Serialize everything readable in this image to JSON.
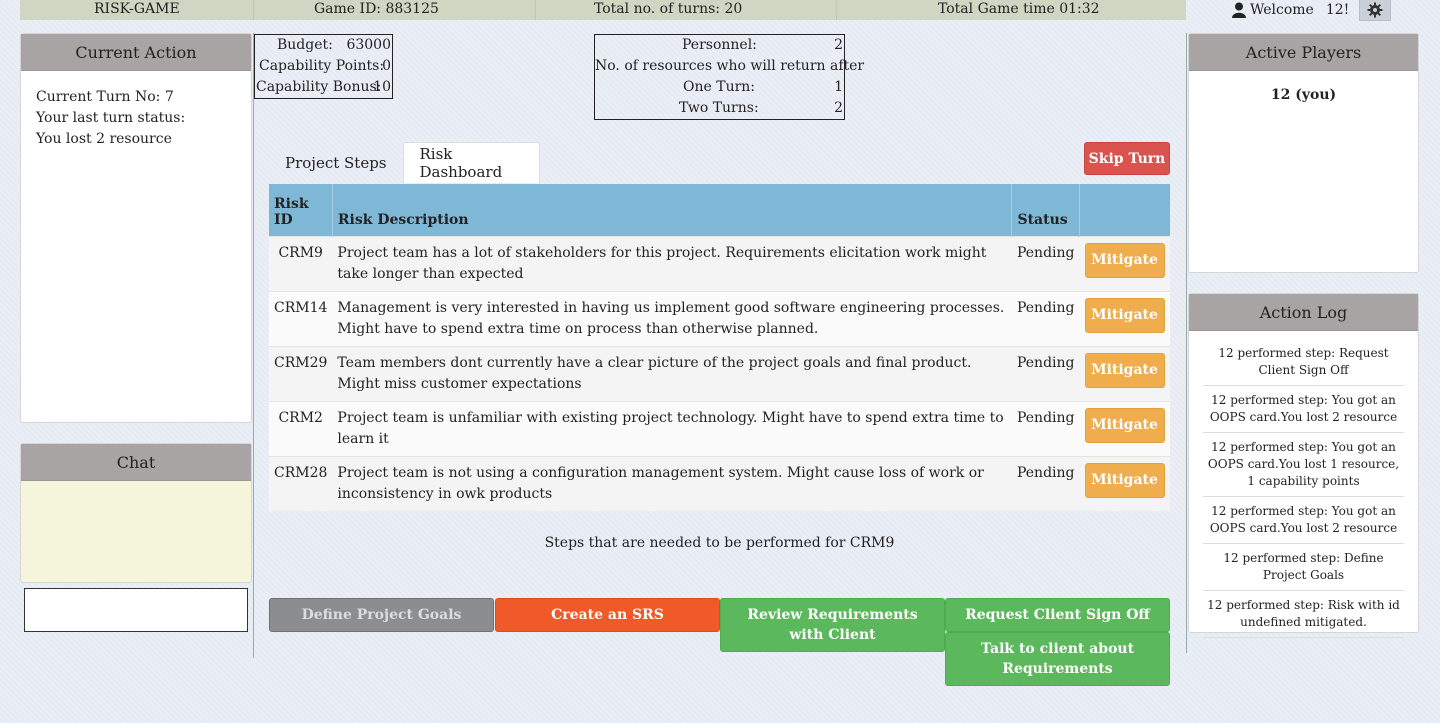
{
  "topbar": {
    "app_name": "RISK-GAME",
    "game_id": "Game  ID: 883125",
    "total_turns": "Total  no. of turns:  20",
    "total_time": "Total Game  time  01:32"
  },
  "user": {
    "welcome": "Welcome",
    "name": "12!"
  },
  "current_action": {
    "title": "Current  Action",
    "lines": [
      "Current  Turn No:  7",
      "Your  last turn  status:",
      "You lost 2 resource"
    ]
  },
  "chat": {
    "title": "Chat",
    "input_value": ""
  },
  "budget": {
    "budget_label": "Budget:",
    "budget_value": "63000",
    "cap_points_label": "Capability  Points:",
    "cap_points_value": "0",
    "cap_bonus_label": "Capability  Bonus:",
    "cap_bonus_value": "10"
  },
  "personnel": {
    "personnel_label": "Personnel:",
    "personnel_value": "2",
    "return_label": "No. of resources  who  will  return  after",
    "one_turn_label": "One  Turn:",
    "one_turn_value": "1",
    "two_turns_label": "Two  Turns:",
    "two_turns_value": "2"
  },
  "tabs": [
    {
      "label": "Project  Steps",
      "active": false
    },
    {
      "label": "Risk  Dashboard",
      "active": true
    }
  ],
  "skip_turn_label": "Skip Turn",
  "table": {
    "headers": {
      "risk_id": "Risk ID",
      "risk_id_l1": "Risk",
      "risk_id_l2": "ID",
      "desc": "Risk  Description",
      "status": "Status"
    },
    "rows": [
      {
        "id": "CRM9",
        "desc": "Project  team  has  a lot of stakeholders   for this project.  Requirements   elicitation  work  might  take  longer  than  expected",
        "status": "Pending",
        "action": "Mitigate"
      },
      {
        "id": "CRM14",
        "desc": "Management   is very interested   in having  us implement   good software  engineering   processes.  Might  have  to spend  extra  time on process  than  otherwise   planned.",
        "status": "Pending",
        "action": "Mitigate"
      },
      {
        "id": "CRM29",
        "desc": "Team members  dont currently   have  a clear picture  of the project goals and final product.  Might  miss customer   expectations",
        "status": "Pending",
        "action": "Mitigate"
      },
      {
        "id": "CRM2",
        "desc": "Project  team  is unfamiliar   with existing  project technology.  Might  have  to spend  extra time to learn  it",
        "status": "Pending",
        "action": "Mitigate"
      },
      {
        "id": "CRM28",
        "desc": "Project  team  is not  using  a configuration    management   system.  Might  cause  loss of work  or inconsistency   in owk  products",
        "status": "Pending",
        "action": "Mitigate"
      }
    ]
  },
  "steps_caption": "Steps  that  are  needed   to be performed   for CRM9",
  "steps": [
    {
      "label": "Define  Project  Goals",
      "color": "#8c8d90"
    },
    {
      "label": "Create  an  SRS",
      "color": "#f05a28"
    },
    {
      "label": "Review  Requirements   with  Client",
      "color": "#5cb85c"
    },
    {
      "label": "Request  Client  Sign  Off",
      "color": "#5cb85c"
    },
    {
      "label": "Talk to client  about  Requirements",
      "color": "#5cb85c"
    }
  ],
  "active_players": {
    "title": "Active  Players",
    "player": "12 (you)"
  },
  "action_log": {
    "title": "Action  Log",
    "items": [
      "12 performed    step:  Request   Client  Sign  Off",
      "12 performed   step:  You got an  OOPS card.You  lost  2 resource",
      "12 performed   step:  You got an  OOPS card.You  lost  1 resource,  1 capability  points",
      "12 performed   step:  You got an  OOPS card.You  lost  2 resource",
      "12 performed    step:  Define  Project  Goals",
      "12 performed    step:  Risk  with  id undefined    mitigated."
    ]
  },
  "colors": {
    "header_bar": "#cfd6c1",
    "table_header": "#7fb8d6",
    "skip": "#d9534f",
    "mitigate": "#f0ad4e"
  }
}
